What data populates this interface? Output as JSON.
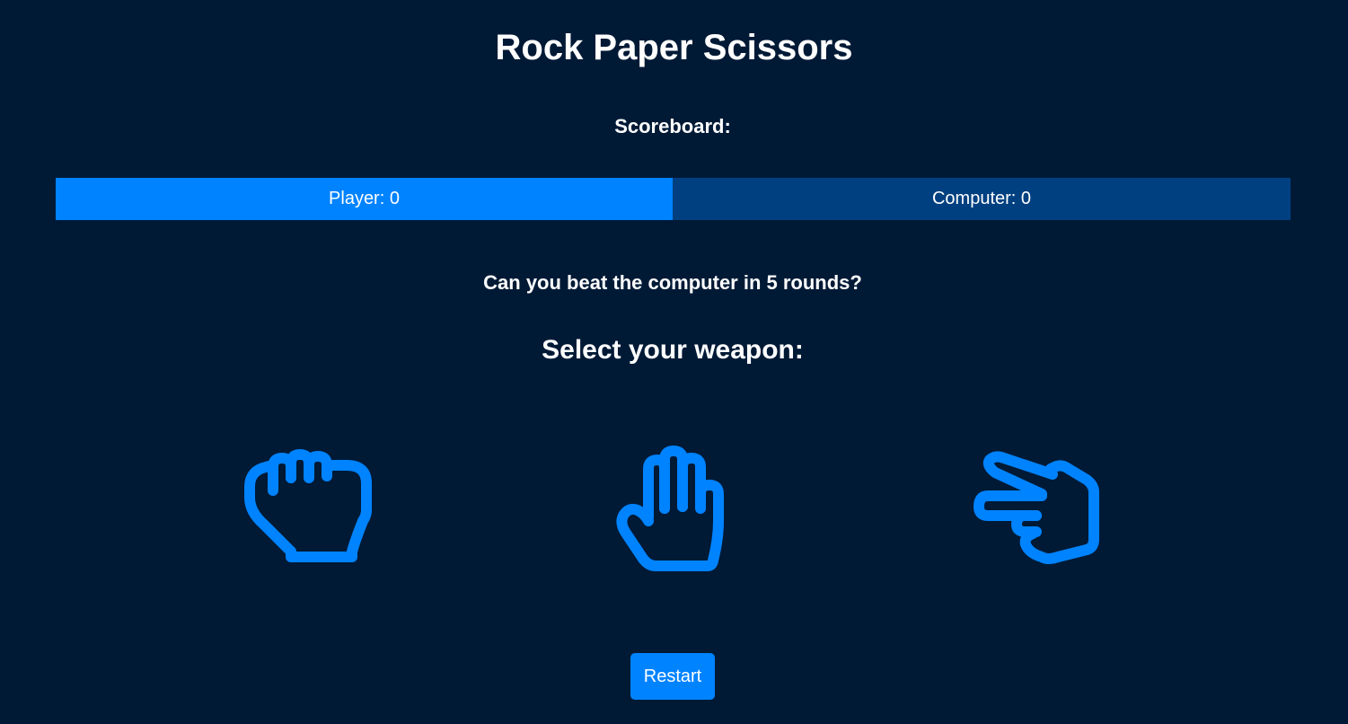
{
  "title": "Rock Paper Scissors",
  "scoreboard": {
    "label": "Scoreboard:",
    "player": "Player: 0",
    "computer": "Computer: 0"
  },
  "challenge": "Can you beat the computer in 5 rounds?",
  "select_label": "Select your weapon:",
  "weapons": [
    {
      "name": "rock",
      "icon": "fist-icon"
    },
    {
      "name": "paper",
      "icon": "open-hand-icon"
    },
    {
      "name": "scissors",
      "icon": "two-fingers-hand-icon"
    }
  ],
  "restart_label": "Restart",
  "colors": {
    "background": "#001a36",
    "accent": "#0083ff",
    "accent_dark": "#004080",
    "text": "#ffffff"
  }
}
